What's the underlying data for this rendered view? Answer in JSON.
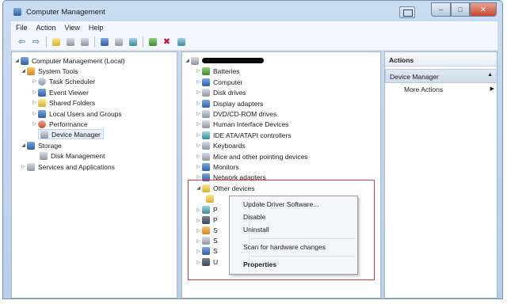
{
  "window": {
    "title": "Computer Management"
  },
  "menubar": [
    "File",
    "Action",
    "View",
    "Help"
  ],
  "left_tree": {
    "root": "Computer Management (Local)",
    "system_tools": "System Tools",
    "task_scheduler": "Task Scheduler",
    "event_viewer": "Event Viewer",
    "shared_folders": "Shared Folders",
    "local_users": "Local Users and Groups",
    "performance": "Performance",
    "device_manager": "Device Manager",
    "storage": "Storage",
    "disk_management": "Disk Management",
    "services_apps": "Services and Applications"
  },
  "device_tree": {
    "items": [
      "Batteries",
      "Computer",
      "Disk drives",
      "Display adapters",
      "DVD/CD-ROM drives",
      "Human Interface Devices",
      "IDE ATA/ATAPI controllers",
      "Keyboards",
      "Mice and other pointing devices",
      "Monitors",
      "Network adapters",
      "Other devices"
    ],
    "partial_letters": [
      "P",
      "P",
      "S",
      "S",
      "S",
      "U"
    ]
  },
  "context_menu": {
    "update_driver": "Update Driver Software...",
    "disable": "Disable",
    "uninstall": "Uninstall",
    "scan": "Scan for hardware changes",
    "properties": "Properties"
  },
  "actions_pane": {
    "header": "Actions",
    "section": "Device Manager",
    "more": "More Actions"
  },
  "colors": {
    "highlight_border": "#e63a3a",
    "titlebar": "#c9dcf2",
    "close_button": "#c8472b"
  }
}
